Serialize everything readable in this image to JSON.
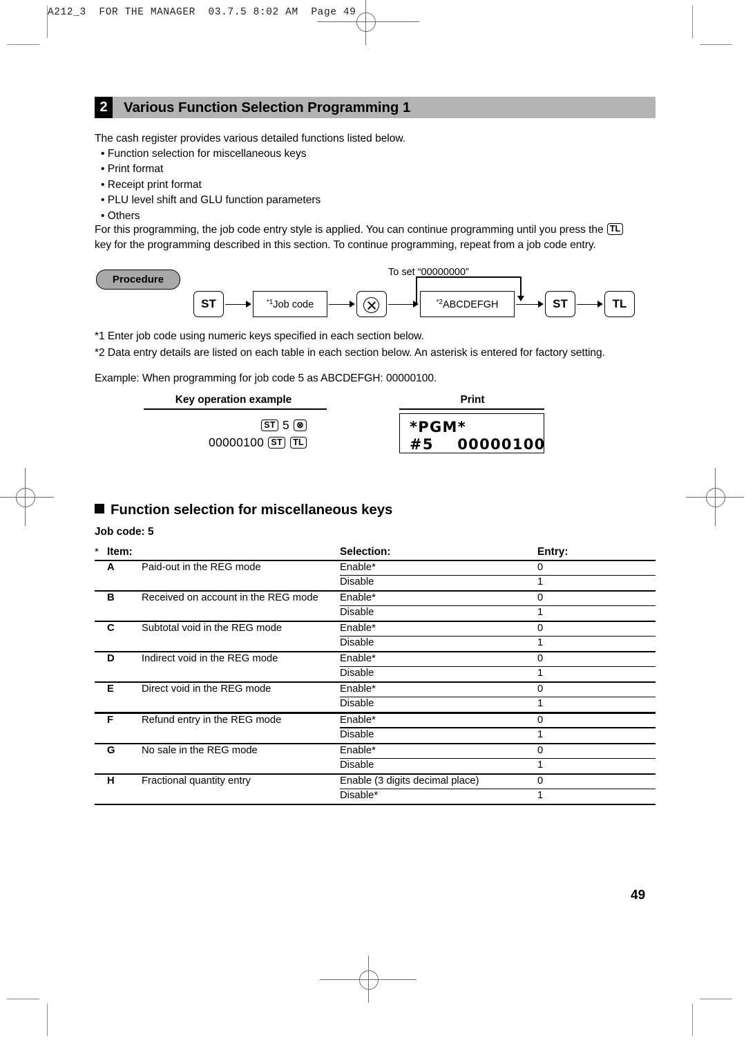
{
  "print_slug": "A212_3  FOR THE MANAGER  03.7.5 8:02 AM  Page 49",
  "section": {
    "number": "2",
    "title": "Various Function Selection Programming 1"
  },
  "intro": {
    "lead": "The cash register provides various detailed functions listed below.",
    "bullets": [
      "• Function selection for miscellaneous keys",
      "• Print format",
      "• Receipt print format",
      "• PLU level shift and GLU function parameters",
      "• Others"
    ],
    "body_1a": "For this programming, the job code entry style is applied.  You can continue programming until you press the ",
    "body_1b": "",
    "body_2": "key for the programming described in this section.  To continue programming, repeat from a job code entry.",
    "inline_key": "TL"
  },
  "procedure": {
    "label": "Procedure",
    "loop_label": "To set “00000000”",
    "nodes": {
      "st1": "ST",
      "jobcode_sup": "*1",
      "jobcode": "Job code",
      "multiply": "multiply-key",
      "data_sup": "*2",
      "data": "ABCDEFGH",
      "st2": "ST",
      "tl": "TL"
    }
  },
  "footnotes": [
    "*1  Enter job code using numeric keys specified in each section below.",
    "*2  Data entry details are listed on each table in each section below.  An asterisk is entered for factory setting."
  ],
  "example": {
    "intro": "Example:  When programming for job code 5 as ABCDEFGH: 00000100.",
    "key_col_header": "Key operation example",
    "print_col_header": "Print",
    "key_ops": {
      "line1_keys": [
        "ST",
        "5",
        "multiply"
      ],
      "line2_value": "00000100",
      "line2_keys": [
        "ST",
        "TL"
      ]
    },
    "receipt": {
      "line1": "*PGM*",
      "line2": "#5    00000100"
    }
  },
  "subsection": {
    "heading": "Function selection for miscellaneous keys",
    "job_code_label": "Job code:",
    "job_code_value": "5"
  },
  "table": {
    "star": "*",
    "headers": {
      "item": "Item:",
      "selection": "Selection:",
      "entry": "Entry:"
    },
    "rows": [
      {
        "letter": "A",
        "item": "Paid-out in the REG mode",
        "options": [
          {
            "selection": "Enable*",
            "entry": "0"
          },
          {
            "selection": "Disable",
            "entry": "1"
          }
        ]
      },
      {
        "letter": "B",
        "item": "Received on account in the REG mode",
        "options": [
          {
            "selection": "Enable*",
            "entry": "0"
          },
          {
            "selection": "Disable",
            "entry": "1"
          }
        ]
      },
      {
        "letter": "C",
        "item": "Subtotal void in the REG mode",
        "options": [
          {
            "selection": "Enable*",
            "entry": "0"
          },
          {
            "selection": "Disable",
            "entry": "1"
          }
        ]
      },
      {
        "letter": "D",
        "item": "Indirect void in the REG mode",
        "options": [
          {
            "selection": "Enable*",
            "entry": "0"
          },
          {
            "selection": "Disable",
            "entry": "1"
          }
        ]
      },
      {
        "letter": "E",
        "item": "Direct void in the REG mode",
        "options": [
          {
            "selection": "Enable*",
            "entry": "0"
          },
          {
            "selection": "Disable",
            "entry": "1"
          }
        ]
      },
      {
        "letter": "F",
        "item": "Refund entry in the REG mode",
        "options": [
          {
            "selection": "Enable*",
            "entry": "0"
          },
          {
            "selection": "Disable",
            "entry": "1"
          }
        ]
      },
      {
        "letter": "G",
        "item": "No sale in the REG mode",
        "options": [
          {
            "selection": "Enable*",
            "entry": "0"
          },
          {
            "selection": "Disable",
            "entry": "1"
          }
        ]
      },
      {
        "letter": "H",
        "item": "Fractional quantity entry",
        "options": [
          {
            "selection": "Enable (3 digits decimal place)",
            "entry": "0"
          },
          {
            "selection": "Disable*",
            "entry": "1"
          }
        ]
      }
    ]
  },
  "page_number": "49"
}
